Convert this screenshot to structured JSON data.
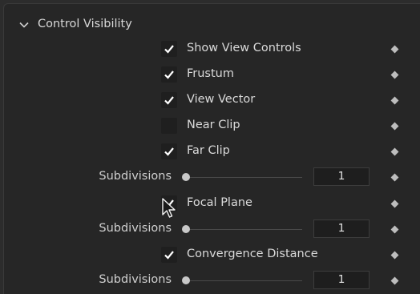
{
  "section": {
    "title": "Control Visibility",
    "expanded": true
  },
  "rows": {
    "show_view_controls": {
      "label": "Show View Controls",
      "checked": true
    },
    "frustum": {
      "label": "Frustum",
      "checked": true
    },
    "view_vector": {
      "label": "View Vector",
      "checked": true
    },
    "near_clip": {
      "label": "Near Clip",
      "checked": false
    },
    "far_clip": {
      "label": "Far Clip",
      "checked": true
    },
    "far_clip_subdivisions": {
      "label": "Subdivisions",
      "value": "1"
    },
    "focal_plane": {
      "label": "Focal Plane",
      "checked": true
    },
    "focal_plane_subdivisions": {
      "label": "Subdivisions",
      "value": "1"
    },
    "convergence_distance": {
      "label": "Convergence Distance",
      "checked": true
    },
    "convergence_subdivisions": {
      "label": "Subdivisions",
      "value": "1"
    }
  },
  "icons": {
    "expand": "chevron-down-icon",
    "check": "checkmark-icon",
    "keyframe": "keyframe-diamond-icon",
    "cursor": "mouse-pointer-icon"
  },
  "colors": {
    "panel_bg": "#262626",
    "text": "#dadada",
    "checkbox_bg": "#1f1f1f",
    "check": "#ffffff",
    "diamond": "#bdbdbd"
  }
}
